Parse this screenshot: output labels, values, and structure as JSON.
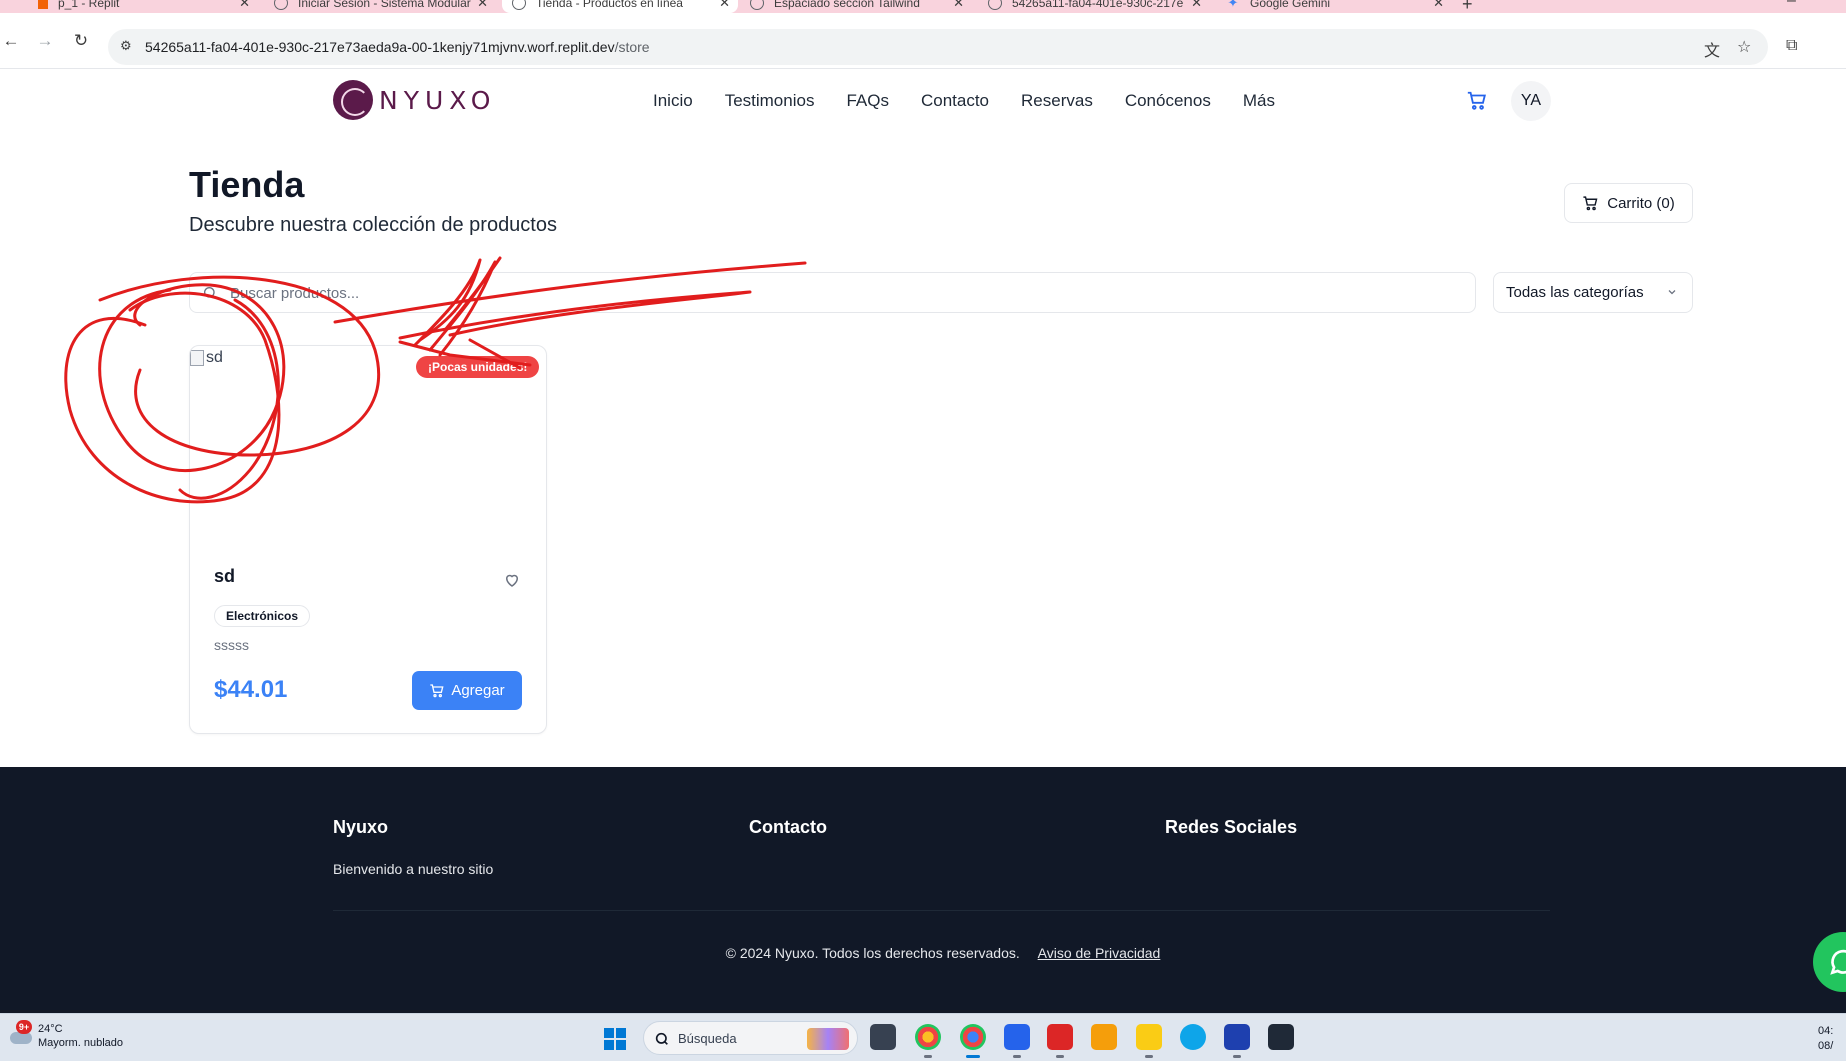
{
  "browser": {
    "tabs": [
      {
        "title": "p_1 - Replit",
        "icon": "replit-icon"
      },
      {
        "title": "Iniciar Sesión - Sistema Modular",
        "icon": "globe-icon"
      },
      {
        "title": "Tienda - Productos en línea",
        "icon": "globe-icon",
        "active": true
      },
      {
        "title": "Espaciado sección Tailwind",
        "icon": "openai-icon"
      },
      {
        "title": "54265a11-fa04-401e-930c-217e",
        "icon": "globe-icon"
      },
      {
        "title": "Google Gemini",
        "icon": "gemini-icon"
      }
    ],
    "url_host": "54265a11-fa04-401e-930c-217e73aeda9a-00-1kenjy71mjvnv.worf.replit.dev",
    "url_path": "/store"
  },
  "header": {
    "logo_text": "NYUXO",
    "nav": [
      "Inicio",
      "Testimonios",
      "FAQs",
      "Contacto",
      "Reservas",
      "Conócenos",
      "Más"
    ],
    "avatar_initials": "YA"
  },
  "store": {
    "title": "Tienda",
    "subtitle": "Descubre nuestra colección de productos",
    "cart_label": "Carrito (0)",
    "search_placeholder": "Buscar productos...",
    "category_selected": "Todas las categorías"
  },
  "product": {
    "image_alt": "sd",
    "badge": "¡Pocas unidades!",
    "name": "sd",
    "category": "Electrónicos",
    "description": "sssss",
    "price": "$44.01",
    "add_label": "Agregar"
  },
  "footer": {
    "col1_title": "Nyuxo",
    "col1_text": "Bienvenido a nuestro sitio",
    "col2_title": "Contacto",
    "col3_title": "Redes Sociales",
    "copyright": "© 2024 Nyuxo. Todos los derechos reservados.",
    "privacy_link": "Aviso de Privacidad"
  },
  "taskbar": {
    "weather_temp": "24°C",
    "weather_desc": "Mayorm. nublado",
    "weather_badge": "9+",
    "search_label": "Búsqueda",
    "clock_time": "04:",
    "clock_date": "08/"
  },
  "colors": {
    "primary": "#3b82f6",
    "badge_red": "#ef4444",
    "footer_bg": "#111827",
    "brand": "#5b1a4a",
    "annotation": "#e11d1d",
    "tab_strip": "#f9d3dd"
  }
}
